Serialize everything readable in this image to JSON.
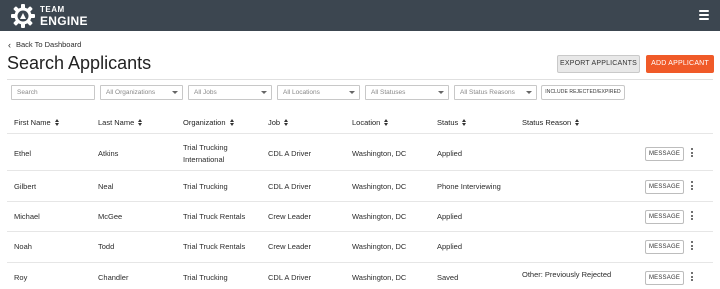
{
  "header": {
    "brand_line1": "TEAM",
    "brand_line2": "ENGINE",
    "colors": {
      "bar": "#3c4650",
      "accent": "#f05a28"
    }
  },
  "nav": {
    "back_label": "Back To Dashboard"
  },
  "page": {
    "title": "Search Applicants"
  },
  "actions": {
    "export_label": "EXPORT APPLICANTS",
    "add_label": "ADD APPLICANT"
  },
  "filters": {
    "search_placeholder": "Search",
    "organizations": "All Organizations",
    "jobs": "All Jobs",
    "locations": "All Locations",
    "statuses": "All Statuses",
    "status_reasons": "All Status Reasons",
    "include_label": "INCLUDE REJECTED/EXPIRED"
  },
  "table": {
    "columns": [
      "First Name",
      "Last Name",
      "Organization",
      "Job",
      "Location",
      "Status",
      "Status Reason"
    ],
    "message_label": "MESSAGE",
    "rows": [
      {
        "first": "Ethel",
        "last": "Atkins",
        "org_line1": "Trial Trucking",
        "org_line2": "International",
        "job": "CDL A Driver",
        "location": "Washington, DC",
        "status": "Applied",
        "reason": ""
      },
      {
        "first": "Gilbert",
        "last": "Neal",
        "org_line1": "Trial Trucking",
        "org_line2": "",
        "job": "CDL A Driver",
        "location": "Washington, DC",
        "status": "Phone Interviewing",
        "reason": ""
      },
      {
        "first": "Michael",
        "last": "McGee",
        "org_line1": "Trial Truck Rentals",
        "org_line2": "",
        "job": "Crew Leader",
        "location": "Washington, DC",
        "status": "Applied",
        "reason": ""
      },
      {
        "first": "Noah",
        "last": "Todd",
        "org_line1": "Trial Truck Rentals",
        "org_line2": "",
        "job": "Crew Leader",
        "location": "Washington, DC",
        "status": "Applied",
        "reason": ""
      },
      {
        "first": "Roy",
        "last": "Chandler",
        "org_line1": "Trial Trucking",
        "org_line2": "",
        "job": "CDL A Driver",
        "location": "Washington, DC",
        "status": "Saved",
        "reason": "Other: Previously Rejected"
      }
    ]
  }
}
